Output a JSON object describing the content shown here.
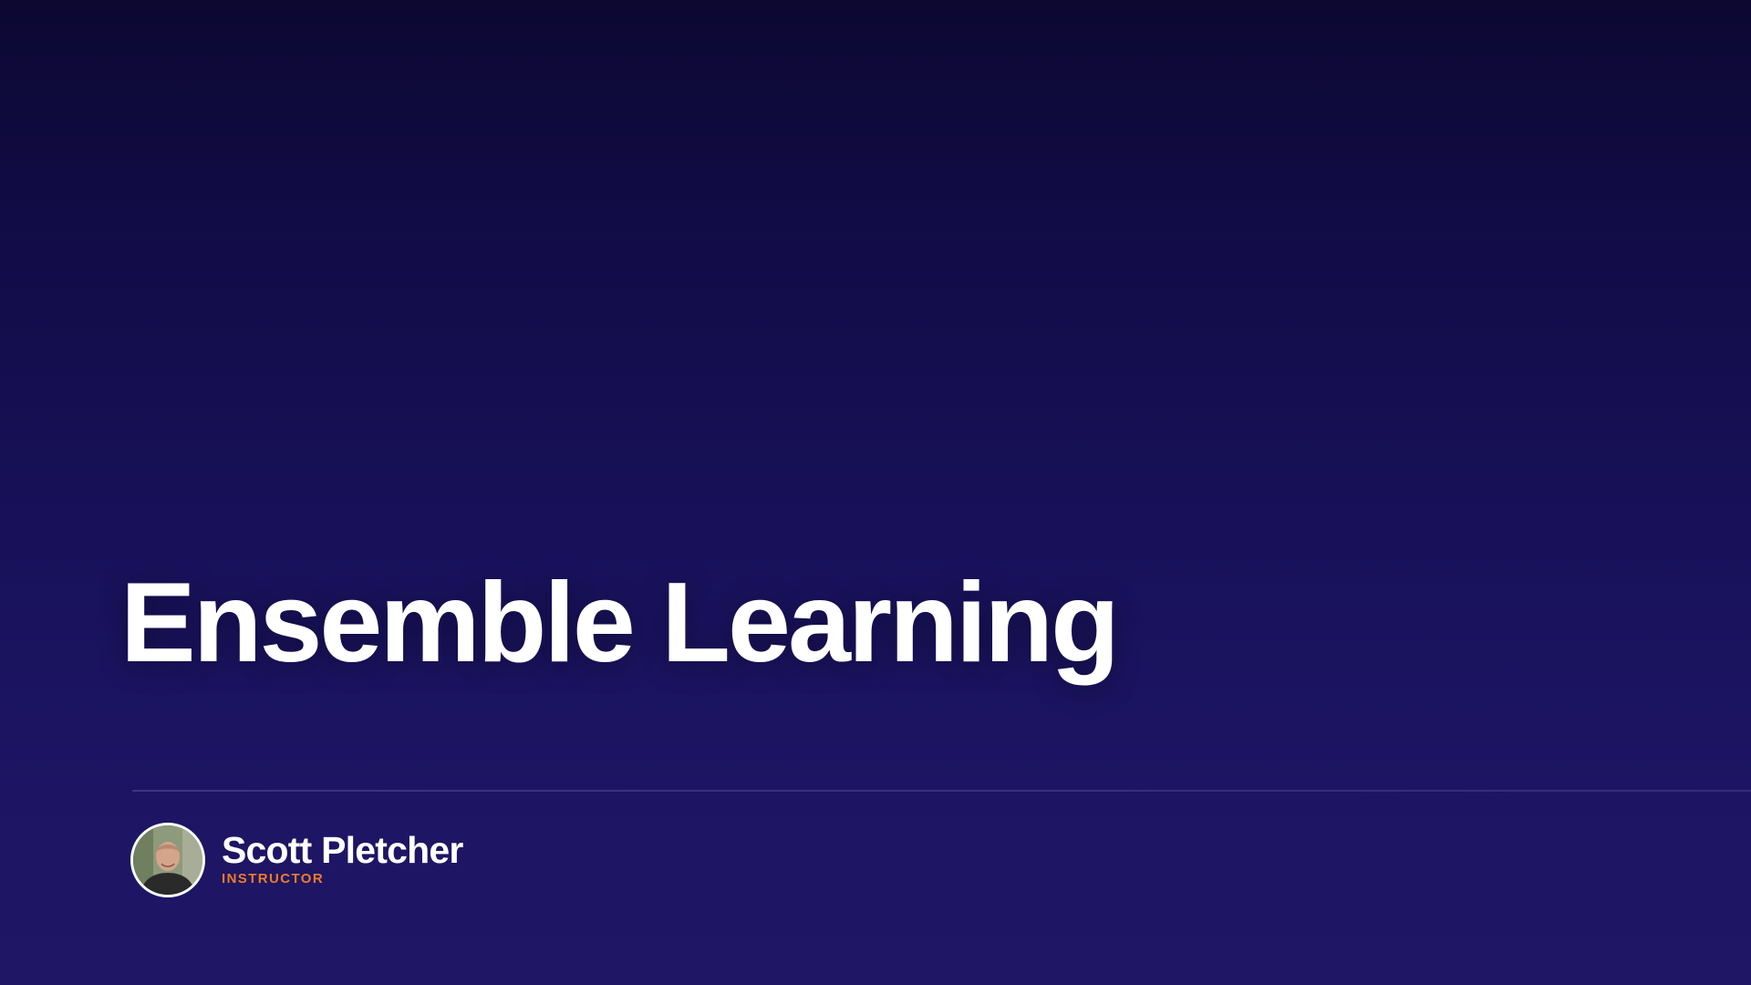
{
  "slide": {
    "title": "Ensemble Learning"
  },
  "instructor": {
    "name": "Scott Pletcher",
    "role": "INSTRUCTOR",
    "avatar": "instructor-avatar-photo"
  },
  "colors": {
    "background_top": "#0c0832",
    "background_bottom": "#1f1666",
    "title": "#ffffff",
    "role_accent": "#f07a2a"
  }
}
